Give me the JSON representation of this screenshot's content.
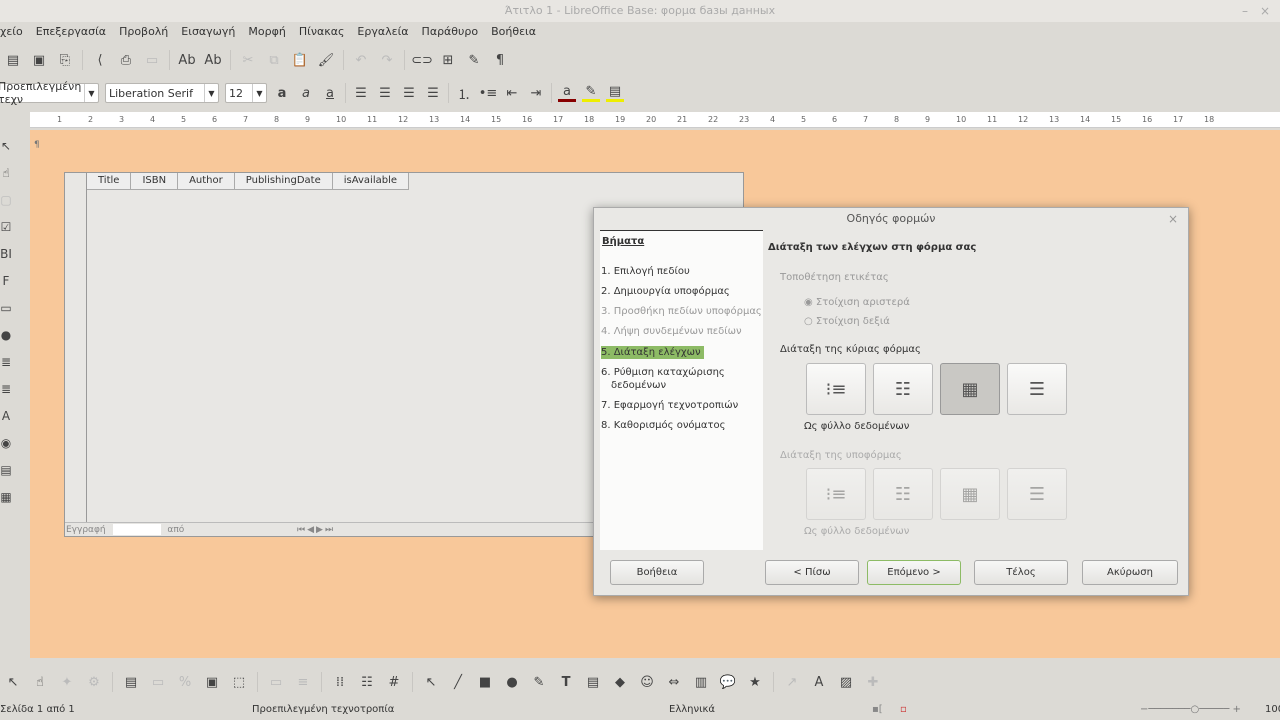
{
  "window": {
    "title": "Άτιτλο 1 - LibreOffice Base: φορμα базы данных",
    "minimize": "–",
    "close": "×"
  },
  "menu": [
    "χείο",
    "Επεξεργασία",
    "Προβολή",
    "Εισαγωγή",
    "Μορφή",
    "Πίνακας",
    "Εργαλεία",
    "Παράθυρο",
    "Βοήθεια"
  ],
  "format": {
    "style": "Προεπιλεγμένη τεχν",
    "font": "Liberation Serif",
    "size": "12"
  },
  "ruler": [
    "1",
    "2",
    "3",
    "4",
    "5",
    "6",
    "7",
    "8",
    "9",
    "10",
    "11",
    "12",
    "13",
    "14",
    "15",
    "16",
    "17",
    "18",
    "19",
    "20",
    "21",
    "22",
    "23",
    "4",
    "5",
    "6",
    "7",
    "8",
    "9",
    "10",
    "11",
    "12",
    "13",
    "14",
    "15",
    "16",
    "17",
    "18"
  ],
  "grid": {
    "columns": [
      "Title",
      "ISBN",
      "Author",
      "PublishingDate",
      "isAvailable"
    ],
    "nav_record": "Εγγραφή",
    "nav_of": "από"
  },
  "dialog": {
    "title": "Οδηγός φορμών",
    "steps_header": "Βήματα",
    "steps": [
      "1. Επιλογή πεδίου",
      "2. Δημιουργία υποφόρμας",
      "3. Προσθήκη πεδίων υποφόρμας",
      "4. Λήψη συνδεμένων πεδίων",
      "5. Διάταξη ελέγχων",
      "6. Ρύθμιση καταχώρισης δεδομένων",
      "7. Εφαρμογή τεχνοτροπιών",
      "8. Καθορισμός ονόματος"
    ],
    "active_step": 4,
    "heading": "Διάταξη των ελέγχων στη φόρμα σας",
    "label_placement": "Τοποθέτηση ετικέτας",
    "align_left": "Στοίχιση αριστερά",
    "align_right": "Στοίχιση δεξιά",
    "main_layout": "Διάταξη της κύριας φόρμας",
    "main_selected": "Ως φύλλο δεδομένων",
    "sub_layout": "Διάταξη της υποφόρμας",
    "sub_selected": "Ως φύλλο δεδομένων",
    "buttons": {
      "help": "Βοήθεια",
      "back": "< Πίσω",
      "next": "Επόμενο >",
      "finish": "Τέλος",
      "cancel": "Ακύρωση"
    }
  },
  "status": {
    "page": "Σελίδα 1 από 1",
    "style": "Προεπιλεγμένη τεχνοτροπία",
    "language": "Ελληνικά",
    "zoom": "100"
  },
  "colors": {
    "canvas": "#f8c89a",
    "active_step": "#8dbb65"
  }
}
